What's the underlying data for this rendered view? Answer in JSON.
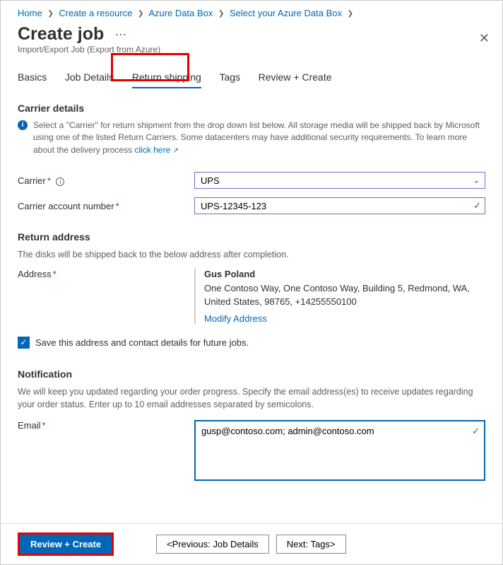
{
  "breadcrumb": [
    "Home",
    "Create a resource",
    "Azure Data Box",
    "Select your Azure Data Box"
  ],
  "header": {
    "title": "Create job",
    "subtitle": "Import/Export Job (Export from Azure)"
  },
  "tabs": [
    "Basics",
    "Job Details",
    "Return shipping",
    "Tags",
    "Review + Create"
  ],
  "active_tab": "Return shipping",
  "carrier_details": {
    "section_title": "Carrier details",
    "info_text": "Select a \"Carrier\" for return shipment from the drop down list below. All storage media will be shipped back by Microsoft using one of the listed Return Carriers. Some datacenters may have additional security requirements. To learn more about the delivery process",
    "info_link": "click here",
    "carrier_label": "Carrier",
    "carrier_value": "UPS",
    "account_label": "Carrier account number",
    "account_value": "UPS-12345-123"
  },
  "return_address": {
    "section_title": "Return address",
    "description": "The disks will be shipped back to the below address after completion.",
    "label": "Address",
    "name": "Gus Poland",
    "address": "One Contoso Way, One Contoso Way, Building 5, Redmond, WA, United States, 98765, +14255550100",
    "modify_link": "Modify Address",
    "save_checkbox_label": "Save this address and contact details for future jobs.",
    "save_checked": true
  },
  "notification": {
    "section_title": "Notification",
    "description": "We will keep you updated regarding your order progress. Specify the email address(es) to receive updates regarding your order status. Enter up to 10 email addresses separated by semicolons.",
    "email_label": "Email",
    "email_value": "gusp@contoso.com; admin@contoso.com"
  },
  "footer": {
    "review": "Review + Create",
    "prev": "<Previous: Job Details",
    "next": "Next: Tags>"
  }
}
